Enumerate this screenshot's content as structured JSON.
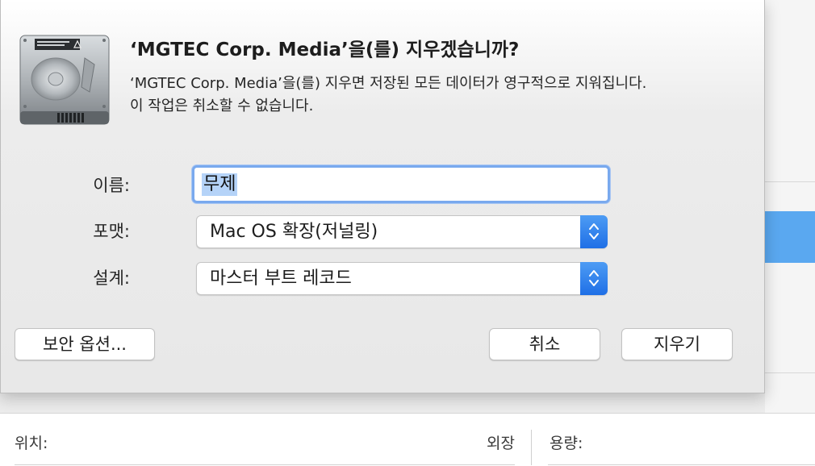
{
  "dialog": {
    "title": "‘MGTEC Corp. Media’을(를) 지우겠습니까?",
    "message_line1": "‘MGTEC Corp. Media’을(를) 지우면 저장된 모든 데이터가 영구적으로 지워집니다.",
    "message_line2": "이 작업은 취소할 수 없습니다.",
    "icon": "hard-disk-icon"
  },
  "form": {
    "name_label": "이름:",
    "name_value": "무제",
    "format_label": "포맷:",
    "format_value": "Mac OS 확장(저널링)",
    "scheme_label": "설계:",
    "scheme_value": "마스터 부트 레코드"
  },
  "buttons": {
    "security_options": "보안 옵션...",
    "cancel": "취소",
    "erase": "지우기"
  },
  "info_panel": {
    "location_label": "위치:",
    "location_value": "외장",
    "capacity_label": "용량:"
  },
  "colors": {
    "accent": "#1f6fe6",
    "selection": "#b5d3f8",
    "sidebar_selected": "#5aa8f0"
  }
}
